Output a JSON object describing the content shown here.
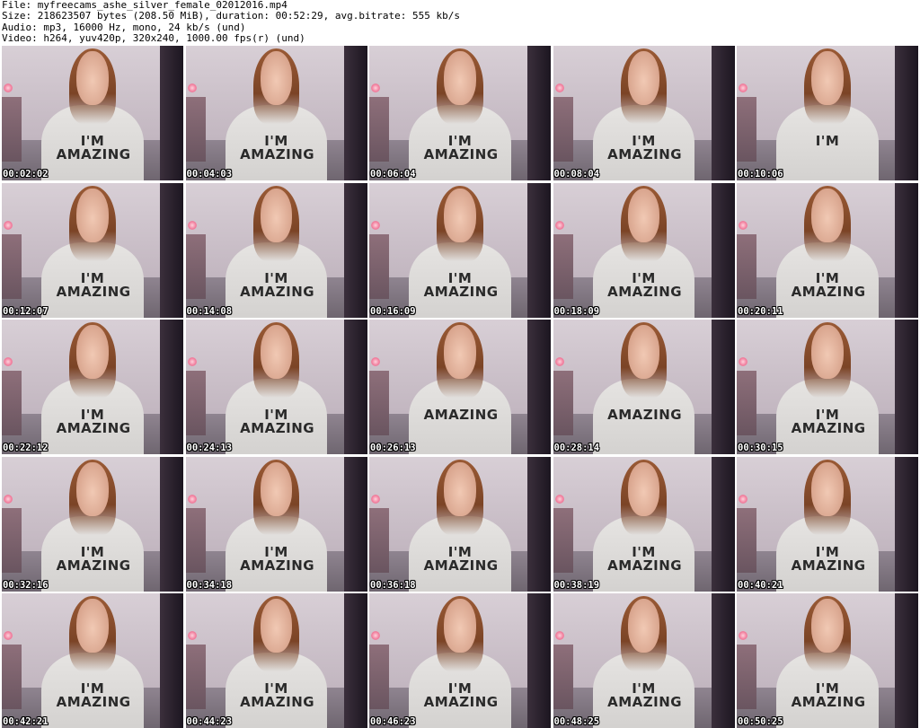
{
  "header": {
    "file": "File: myfreecams_ashe_silver_female_02012016.mp4",
    "size": "Size: 218623507 bytes (208.50 MiB), duration: 00:52:29, avg.bitrate: 555 kb/s",
    "audio": "Audio: mp3, 16000 Hz, mono, 24 kb/s (und)",
    "video": "Video: h264, yuv420p, 320x240, 1000.00 fps(r) (und)"
  },
  "thumbnails": [
    {
      "timestamp": "00:02:02",
      "shirt": "I'M\nAMAZING"
    },
    {
      "timestamp": "00:04:03",
      "shirt": "I'M\nAMAZING"
    },
    {
      "timestamp": "00:06:04",
      "shirt": "I'M\nAMAZING"
    },
    {
      "timestamp": "00:08:04",
      "shirt": "I'M\nAMAZING"
    },
    {
      "timestamp": "00:10:06",
      "shirt": "I'M"
    },
    {
      "timestamp": "00:12:07",
      "shirt": "I'M\nAMAZING"
    },
    {
      "timestamp": "00:14:08",
      "shirt": "I'M\nAMAZING"
    },
    {
      "timestamp": "00:16:09",
      "shirt": "I'M\nAMAZING"
    },
    {
      "timestamp": "00:18:09",
      "shirt": "I'M\nAMAZING"
    },
    {
      "timestamp": "00:20:11",
      "shirt": "I'M\nAMAZING"
    },
    {
      "timestamp": "00:22:12",
      "shirt": "I'M\nAMAZING"
    },
    {
      "timestamp": "00:24:13",
      "shirt": "I'M\nAMAZING"
    },
    {
      "timestamp": "00:26:13",
      "shirt": "AMAZING"
    },
    {
      "timestamp": "00:28:14",
      "shirt": "AMAZING"
    },
    {
      "timestamp": "00:30:15",
      "shirt": "I'M\nAMAZING"
    },
    {
      "timestamp": "00:32:16",
      "shirt": "I'M\nAMAZING"
    },
    {
      "timestamp": "00:34:18",
      "shirt": "I'M\nAMAZING"
    },
    {
      "timestamp": "00:36:18",
      "shirt": "I'M\nAMAZING"
    },
    {
      "timestamp": "00:38:19",
      "shirt": "I'M\nAMAZING"
    },
    {
      "timestamp": "00:40:21",
      "shirt": "I'M\nAMAZING"
    },
    {
      "timestamp": "00:42:21",
      "shirt": "I'M\nAMAZING"
    },
    {
      "timestamp": "00:44:23",
      "shirt": "I'M\nAMAZING"
    },
    {
      "timestamp": "00:46:23",
      "shirt": "I'M\nAMAZING"
    },
    {
      "timestamp": "00:48:25",
      "shirt": "I'M\nAMAZING"
    },
    {
      "timestamp": "00:50:25",
      "shirt": "I'M\nAMAZING"
    }
  ],
  "colors": {
    "background": "#ffffff",
    "header_text": "#000000",
    "timestamp_text": "#ffffff",
    "timestamp_outline": "#000000"
  }
}
